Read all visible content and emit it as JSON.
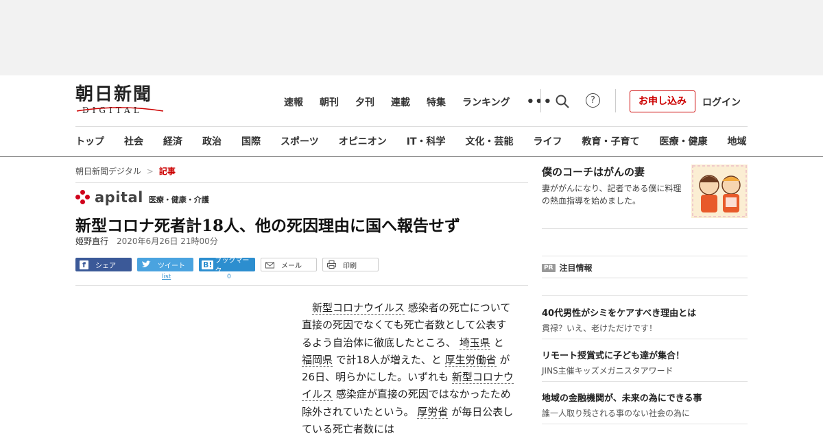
{
  "site": {
    "logo_title": "朝日新聞",
    "logo_sub": "DIGITAL"
  },
  "topnav": [
    "速報",
    "朝刊",
    "夕刊",
    "連載",
    "特集",
    "ランキング"
  ],
  "more_label": "•••",
  "help_label": "?",
  "apply_label": "お申し込み",
  "login_label": "ログイン",
  "catnav": [
    "トップ",
    "社会",
    "経済",
    "政治",
    "国際",
    "スポーツ",
    "オピニオン",
    "IT・科学",
    "文化・芸能",
    "ライフ",
    "教育・子育て",
    "医療・健康",
    "地域"
  ],
  "breadcrumb": {
    "home": "朝日新聞デジタル",
    "sep": ">",
    "current": "記事"
  },
  "apital": {
    "word": "apital",
    "category": "医療・健康・介護"
  },
  "article": {
    "headline": "新型コロナ死者計18人、他の死因理由に国へ報告せず",
    "author": "姫野直行",
    "date": "2020年6月26日 21時00分",
    "body": [
      {
        "t": "　"
      },
      {
        "t": "新型コロナウイルス",
        "link": true
      },
      {
        "t": " 感染者の死亡について直接の死因でなくても死亡者数として公表するよう自治体に徹底したところ、 "
      },
      {
        "t": "埼玉県",
        "link": true
      },
      {
        "t": " と "
      },
      {
        "t": "福岡県",
        "link": true
      },
      {
        "t": " で計18人が増えた、と "
      },
      {
        "t": "厚生労働省",
        "link": true
      },
      {
        "t": " が26日、明らかにした。いずれも "
      },
      {
        "t": "新型コロナウイルス",
        "link": true
      },
      {
        "t": " 感染症が直接の死因ではなかったため除外されていたという。 "
      },
      {
        "t": "厚労省",
        "link": true
      },
      {
        "t": " が毎日公表している死亡者数には"
      }
    ]
  },
  "share": {
    "facebook": "シェア",
    "facebook_icon": "f",
    "twitter": "ツイート",
    "twitter_sub": "list",
    "hatena": "ブックマーク",
    "hatena_icon": "B!",
    "hatena_count": "0",
    "mail": "メール",
    "print": "印刷"
  },
  "sidebar": {
    "feature_title": "僕のコーチはがんの妻",
    "feature_desc": "妻ががんになり、記者である僕に料理の熱血指導を始めました。",
    "pr_badge": "PR",
    "pr_heading": "注目情報",
    "pr_items": [
      {
        "title": "40代男性がシミをケアすべき理由とは",
        "desc": "貫禄？いえ、老けただけです！"
      },
      {
        "title": "リモート授賞式に子ども達が集合！",
        "desc": "JINS主催キッズメガニスタアワード"
      },
      {
        "title": "地域の金融機関が、未来の為にできる事",
        "desc": "誰一人取り残される事のない社会の為に"
      }
    ]
  },
  "colors": {
    "brand_red": "#cc0000",
    "facebook": "#3b5998",
    "twitter": "#4aa3df",
    "hatena": "#2c8ecf"
  }
}
